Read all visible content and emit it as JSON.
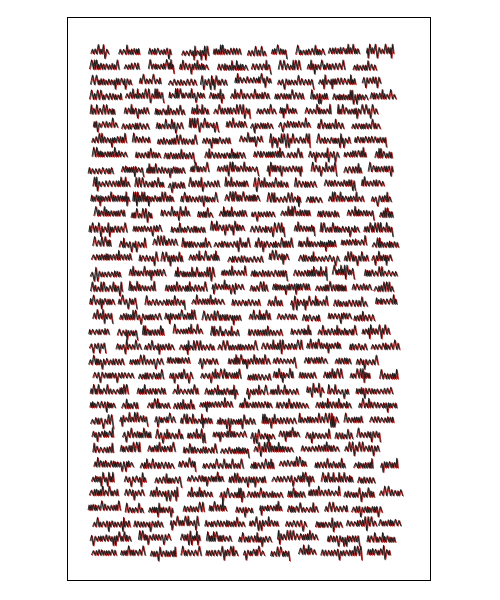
{
  "document": {
    "type": "handwritten-page",
    "text_legible": false,
    "line_count": 35,
    "ink_colors": {
      "primary": "#1a1a1a",
      "shadow": "#b31b1b"
    }
  }
}
